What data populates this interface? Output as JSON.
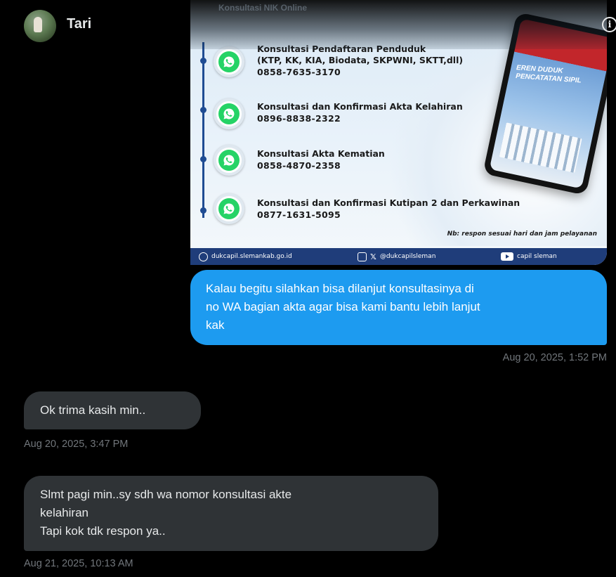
{
  "header": {
    "contact_name": "Tari",
    "info_icon": "info-icon"
  },
  "image": {
    "top_partial_text": "Konsultasi NIK Online",
    "services": [
      {
        "title_lines": [
          "Konsultasi Pendaftaran Penduduk",
          "(KTP, KK, KIA, Biodata, SKPWNI, SKTT,dll)"
        ],
        "phone": "0858-7635-3170"
      },
      {
        "title_lines": [
          "Konsultasi dan Konfirmasi Akta Kelahiran"
        ],
        "phone": "0896-8838-2322"
      },
      {
        "title_lines": [
          "Konsultasi Akta Kematian"
        ],
        "phone": "0858-4870-2358"
      },
      {
        "title_lines": [
          "Konsultasi dan Konfirmasi Kutipan 2 dan Perkawinan"
        ],
        "phone": "0877-1631-5095"
      }
    ],
    "note": "Nb: respon sesuai hari dan jam pelayanan",
    "footer": {
      "website": "dukcapil.slemankab.go.id",
      "social": "@dukcapilsleman",
      "youtube": "capil sleman"
    },
    "phone_screen_text": [
      "EREN DUDUK",
      "PENCATATAN SIPIL"
    ]
  },
  "messages": [
    {
      "direction": "outgoing",
      "lines": [
        "Kalau begitu silahkan bisa dilanjut konsultasinya di",
        "no WA bagian akta agar bisa kami bantu lebih lanjut",
        "kak"
      ],
      "timestamp": "Aug 20, 2025, 1:52 PM"
    },
    {
      "direction": "incoming",
      "lines": [
        "Ok trima kasih min.."
      ],
      "timestamp": "Aug 20, 2025, 3:47 PM"
    },
    {
      "direction": "incoming",
      "lines": [
        "Slmt pagi min..sy sdh wa nomor konsultasi akte",
        "kelahiran",
        "Tapi kok tdk respon ya.."
      ],
      "timestamp": "Aug 21, 2025, 10:13 AM"
    }
  ],
  "colors": {
    "background": "#000000",
    "outgoing_bubble": "#1d9bf0",
    "incoming_bubble": "#2f3336",
    "timestamp": "#71767b",
    "whatsapp_green": "#25d366",
    "poster_blue": "#1f3d7a"
  }
}
